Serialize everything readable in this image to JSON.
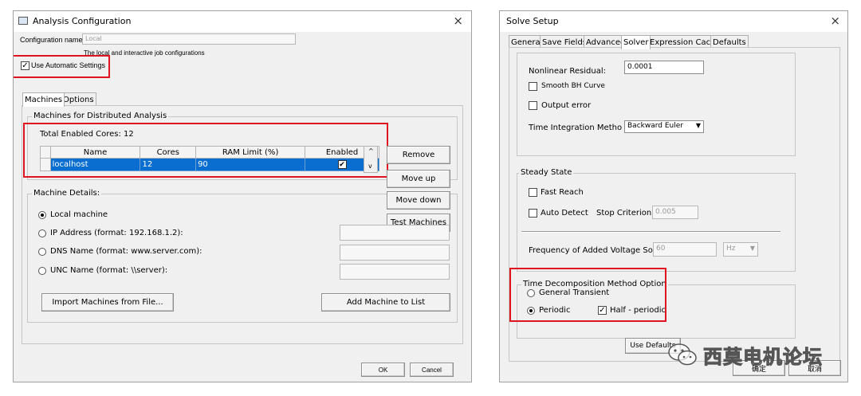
{
  "analysis": {
    "title": "Analysis Configuration",
    "close_icon": "×",
    "config_name_label": "Configuration name:",
    "config_name_value": "Local",
    "description": "The local and interactive job configurations",
    "use_auto_settings": "Use Automatic Settings",
    "tabs": [
      "Machines",
      "Options"
    ],
    "machines_group": "Machines for Distributed Analysis",
    "total_cores": "Total Enabled Cores: 12",
    "columns": [
      "Name",
      "Cores",
      "RAM Limit (%)",
      "Enabled"
    ],
    "rows": [
      {
        "name": "localhost",
        "cores": "12",
        "ram": "90",
        "enabled": "✔"
      }
    ],
    "side_buttons": [
      "Remove",
      "Move up",
      "Move down",
      "Test Machines"
    ],
    "details_group": "Machine Details:",
    "options": [
      "Local machine",
      "IP Address (format: 192.168.1.2):",
      "DNS Name (format: www.server.com):",
      "UNC Name (format: \\\\server):"
    ],
    "import_button": "Import Machines from File...",
    "add_button": "Add Machine to List",
    "ok": "OK",
    "cancel": "Cancel",
    "accent": "#0a6ed1",
    "highlight": "#e0141e"
  },
  "solve": {
    "title": "Solve Setup",
    "close_icon": "×",
    "tabs": [
      "General",
      "Save Fields",
      "Advanced",
      "Solver",
      "Expression Cache",
      "Defaults"
    ],
    "nonlinear_label": "Nonlinear Residual:",
    "nonlinear_value": "0.0001",
    "smooth_bh": "Smooth BH Curve",
    "output_error": "Output error",
    "time_integration_label": "Time Integration Metho",
    "time_integration_value": "Backward Euler",
    "steady_group": "Steady State",
    "fast_reach": "Fast Reach",
    "auto_detect": "Auto Detect",
    "stop_criterion_label": "Stop Criterion:",
    "stop_criterion_value": "0.005",
    "freq_label": "Frequency of Added Voltage Source",
    "freq_value": "60",
    "freq_unit": "Hz",
    "tdm_group": "Time Decomposition Method Option",
    "general_transient": "General Transient",
    "periodic": "Periodic",
    "half_periodic": "Half - periodic",
    "use_defaults": "Use Defaults",
    "ok": "确定",
    "cancel": "取消"
  },
  "watermark": {
    "text": "西莫电机论坛",
    "icon": "wechat-icon"
  }
}
